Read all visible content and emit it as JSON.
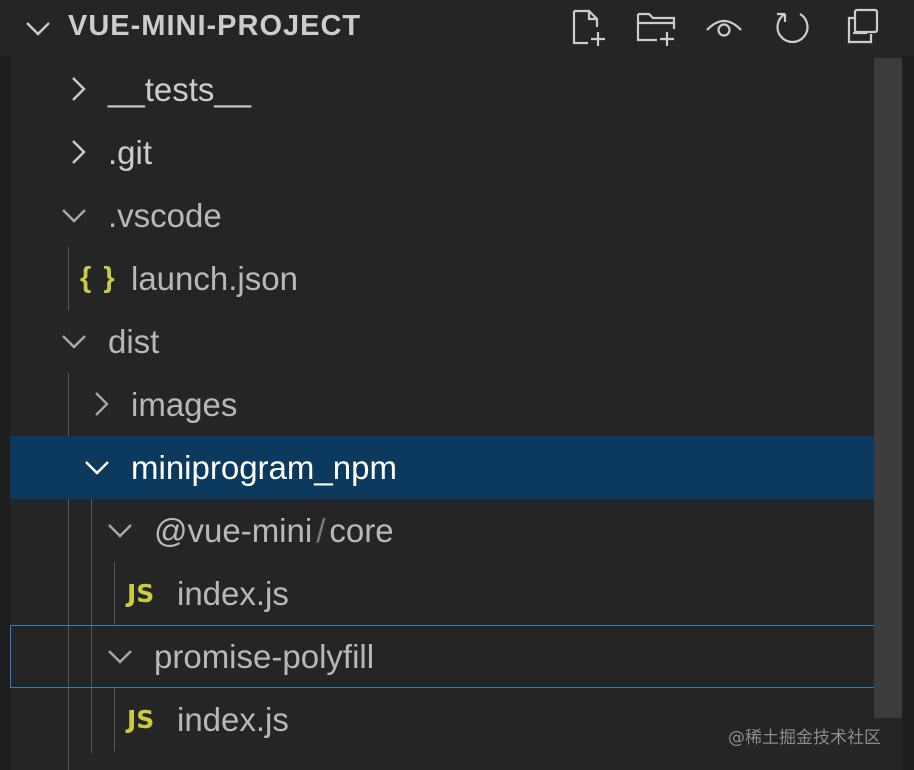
{
  "explorer": {
    "title": "VUE-MINI-PROJECT",
    "toolbar": [
      {
        "name": "new-file-icon",
        "label": "New File"
      },
      {
        "name": "new-folder-icon",
        "label": "New Folder"
      },
      {
        "name": "eye-icon",
        "label": "Preview"
      },
      {
        "name": "refresh-icon",
        "label": "Refresh Explorer"
      },
      {
        "name": "collapse-all-icon",
        "label": "Collapse Folders in View"
      }
    ]
  },
  "tree": [
    {
      "label": "__tests__",
      "type": "folder",
      "expanded": false
    },
    {
      "label": ".git",
      "type": "folder",
      "expanded": false
    },
    {
      "label": ".vscode",
      "type": "folder",
      "expanded": true
    },
    {
      "label": "launch.json",
      "type": "file",
      "icon": "{ }"
    },
    {
      "label": "dist",
      "type": "folder",
      "expanded": true
    },
    {
      "label": "images",
      "type": "folder",
      "expanded": false
    },
    {
      "label": "miniprogram_npm",
      "type": "folder",
      "expanded": true,
      "selected": true
    },
    {
      "label_a": "@vue-mini",
      "separator": "/",
      "label_b": "core",
      "type": "folder",
      "expanded": true
    },
    {
      "label": "index.js",
      "type": "file",
      "icon": "JS"
    },
    {
      "label": "promise-polyfill",
      "type": "folder",
      "expanded": true,
      "focused": true
    },
    {
      "label": "index.js",
      "type": "file",
      "icon": "JS"
    }
  ],
  "colors": {
    "background": "#252526",
    "selected": "#0c3a5e",
    "focus_border": "#2f7fc8",
    "file_icon": "#cbcb41"
  },
  "watermark": "@稀土掘金技术社区"
}
